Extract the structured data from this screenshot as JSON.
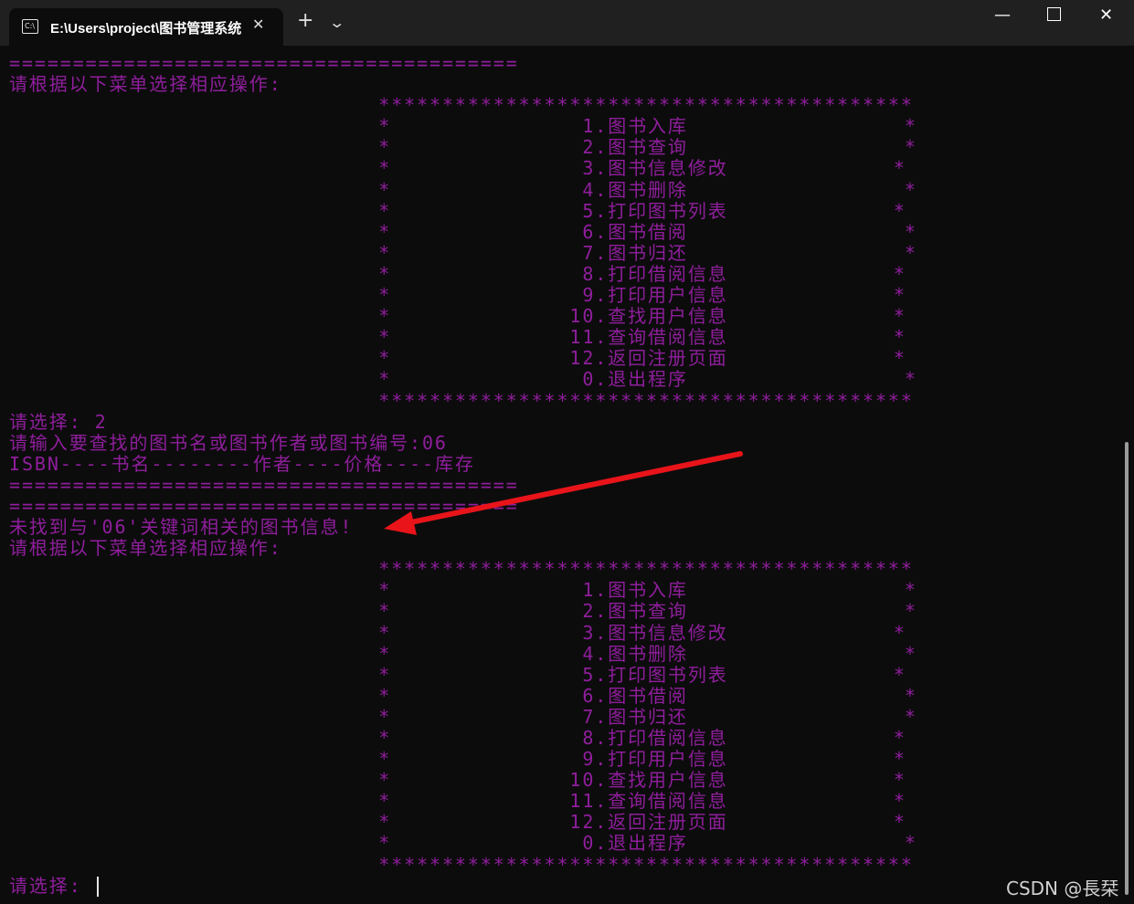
{
  "window": {
    "tab_title": "E:\\Users\\project\\图书管理系统",
    "tab_icon_text": "C:\\",
    "tab_close": "✕",
    "new_tab": "+",
    "dropdown": "⌄",
    "minimize": "—",
    "close": "✕"
  },
  "terminal": {
    "lines": [
      "========================================",
      "请根据以下菜单选择相应操作:",
      "                             ******************************************",
      "                             *               1.图书入库                 *",
      "                             *               2.图书查询                 *",
      "                             *               3.图书信息修改             *",
      "                             *               4.图书删除                 *",
      "                             *               5.打印图书列表             *",
      "                             *               6.图书借阅                 *",
      "                             *               7.图书归还                 *",
      "                             *               8.打印借阅信息             *",
      "                             *               9.打印用户信息             *",
      "                             *              10.查找用户信息             *",
      "                             *              11.查询借阅信息             *",
      "                             *              12.返回注册页面             *",
      "                             *               0.退出程序                 *",
      "                             ******************************************",
      "请选择: 2",
      "请输入要查找的图书名或图书作者或图书编号:06",
      "ISBN----书名--------作者----价格----库存",
      "========================================",
      "========================================",
      "未找到与'06'关键词相关的图书信息!",
      "请根据以下菜单选择相应操作:",
      "                             ******************************************",
      "                             *               1.图书入库                 *",
      "                             *               2.图书查询                 *",
      "                             *               3.图书信息修改             *",
      "                             *               4.图书删除                 *",
      "                             *               5.打印图书列表             *",
      "                             *               6.图书借阅                 *",
      "                             *               7.图书归还                 *",
      "                             *               8.打印借阅信息             *",
      "                             *               9.打印用户信息             *",
      "                             *              10.查找用户信息             *",
      "                             *              11.查询借阅信息             *",
      "                             *              12.返回注册页面             *",
      "                             *               0.退出程序                 *",
      "                             ******************************************"
    ],
    "prompt": "请选择: "
  },
  "watermark": "CSDN @長栞",
  "colors": {
    "text": "#8f1e9c",
    "background": "#0c0c0c",
    "arrow": "#e8141a"
  }
}
